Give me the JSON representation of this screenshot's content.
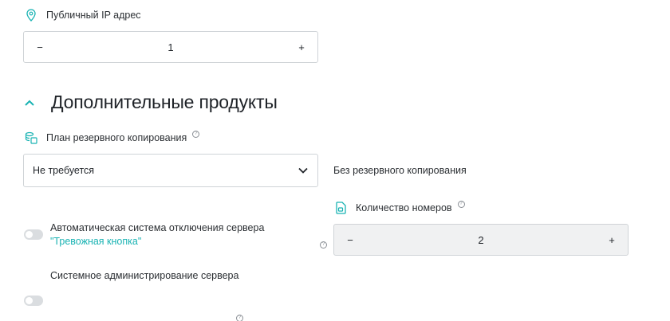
{
  "ip": {
    "label": "Публичный IP адрес",
    "icon": "location-pin-icon",
    "value": "1",
    "minus": "−",
    "plus": "+"
  },
  "section": {
    "title": "Дополнительные продукты",
    "accent": "#1ab3b3"
  },
  "backup": {
    "label": "План резервного копирования",
    "help": "?",
    "icon": "database-icon",
    "selected": "Не требуется",
    "status": "Без резервного копирования"
  },
  "numbers": {
    "label": "Количество номеров",
    "help": "?",
    "icon": "sim-card-icon",
    "value": "2",
    "minus": "−",
    "plus": "+"
  },
  "options": {
    "panic": {
      "text": "Автоматическая система отключения сервера ",
      "link": "\"Тревожная кнопка\"",
      "help": "?",
      "enabled": false
    },
    "admin": {
      "text": "Системное администрирование сервера",
      "help": "?",
      "enabled": false
    }
  }
}
